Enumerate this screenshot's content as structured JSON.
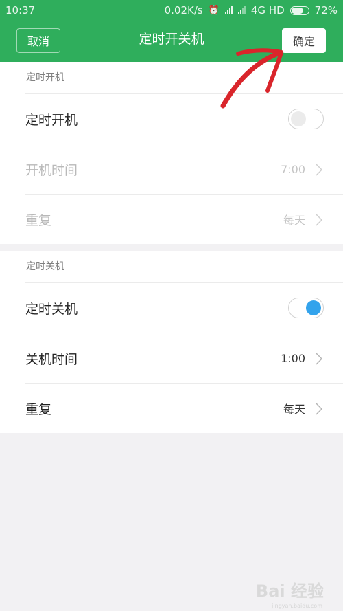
{
  "status_bar": {
    "time": "10:37",
    "speed": "0.02K/s",
    "network": "4G HD",
    "battery": "72%",
    "battery_level": 0.72
  },
  "nav": {
    "cancel_label": "取消",
    "title": "定时开关机",
    "confirm_label": "确定"
  },
  "power_on": {
    "header": "定时开机",
    "toggle_label": "定时开机",
    "toggle_on": false,
    "time_label": "开机时间",
    "time_value": "7:00",
    "repeat_label": "重复",
    "repeat_value": "每天"
  },
  "power_off": {
    "header": "定时关机",
    "toggle_label": "定时关机",
    "toggle_on": true,
    "time_label": "关机时间",
    "time_value": "1:00",
    "repeat_label": "重复",
    "repeat_value": "每天"
  },
  "colors": {
    "header": "#2fae5c",
    "toggle_on": "#33a3ec",
    "annotation": "#d9252b"
  },
  "watermark": {
    "text": "Bai 经验",
    "sub": "jingyan.baidu.com"
  }
}
